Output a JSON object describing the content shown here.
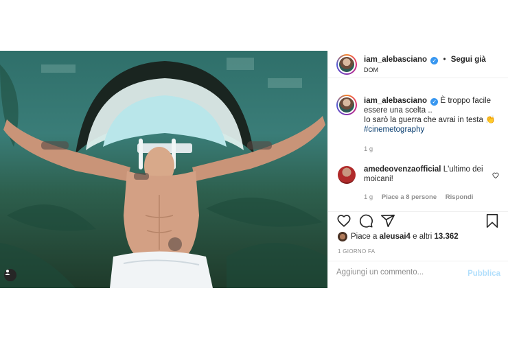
{
  "post": {
    "author": "iam_alebasciano",
    "follow_separator": "•",
    "follow_label": "Segui già",
    "location": "DOM",
    "caption_line1": "È troppo facile essere una scelta ..",
    "caption_line2": "Io sarò la guerra che avrai in testa",
    "caption_emoji": "👏",
    "hashtag": "#cinemetography",
    "caption_time": "1 g",
    "comments": [
      {
        "user": "amedeovenzaofficial",
        "text": "L'ultimo dei moicani!",
        "time": "1 g",
        "likes": "Piace a 8 persone",
        "reply_label": "Rispondi"
      }
    ],
    "liked_by_prefix": "Piace a",
    "liked_by_user": "aleusai4",
    "liked_by_suffix": "e altri",
    "like_count": "13.362",
    "post_time": "1 GIORNO FA",
    "comment_placeholder": "Aggiungi un commento...",
    "publish_label": "Pubblica"
  },
  "colors": {
    "verified": "#3897f0",
    "link": "#00376b",
    "muted": "#8e8e8e",
    "publish_disabled": "#b2dffc"
  },
  "icons": [
    "verified-badge-icon",
    "heart-icon",
    "comment-icon",
    "share-icon",
    "bookmark-icon",
    "user-tag-icon",
    "small-heart-icon"
  ]
}
